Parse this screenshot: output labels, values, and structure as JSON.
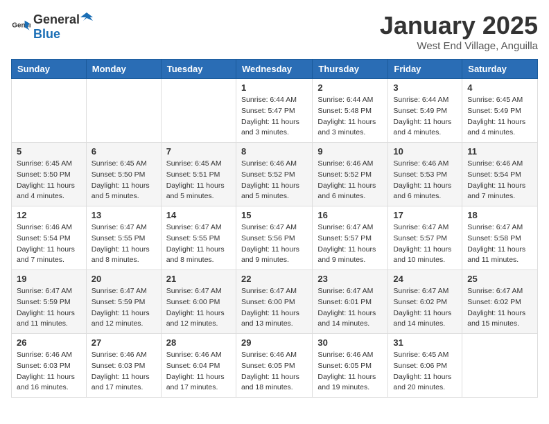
{
  "header": {
    "logo_general": "General",
    "logo_blue": "Blue",
    "month_year": "January 2025",
    "location": "West End Village, Anguilla"
  },
  "weekdays": [
    "Sunday",
    "Monday",
    "Tuesday",
    "Wednesday",
    "Thursday",
    "Friday",
    "Saturday"
  ],
  "weeks": [
    [
      {
        "day": "",
        "info": ""
      },
      {
        "day": "",
        "info": ""
      },
      {
        "day": "",
        "info": ""
      },
      {
        "day": "1",
        "info": "Sunrise: 6:44 AM\nSunset: 5:47 PM\nDaylight: 11 hours\nand 3 minutes."
      },
      {
        "day": "2",
        "info": "Sunrise: 6:44 AM\nSunset: 5:48 PM\nDaylight: 11 hours\nand 3 minutes."
      },
      {
        "day": "3",
        "info": "Sunrise: 6:44 AM\nSunset: 5:49 PM\nDaylight: 11 hours\nand 4 minutes."
      },
      {
        "day": "4",
        "info": "Sunrise: 6:45 AM\nSunset: 5:49 PM\nDaylight: 11 hours\nand 4 minutes."
      }
    ],
    [
      {
        "day": "5",
        "info": "Sunrise: 6:45 AM\nSunset: 5:50 PM\nDaylight: 11 hours\nand 4 minutes."
      },
      {
        "day": "6",
        "info": "Sunrise: 6:45 AM\nSunset: 5:50 PM\nDaylight: 11 hours\nand 5 minutes."
      },
      {
        "day": "7",
        "info": "Sunrise: 6:45 AM\nSunset: 5:51 PM\nDaylight: 11 hours\nand 5 minutes."
      },
      {
        "day": "8",
        "info": "Sunrise: 6:46 AM\nSunset: 5:52 PM\nDaylight: 11 hours\nand 5 minutes."
      },
      {
        "day": "9",
        "info": "Sunrise: 6:46 AM\nSunset: 5:52 PM\nDaylight: 11 hours\nand 6 minutes."
      },
      {
        "day": "10",
        "info": "Sunrise: 6:46 AM\nSunset: 5:53 PM\nDaylight: 11 hours\nand 6 minutes."
      },
      {
        "day": "11",
        "info": "Sunrise: 6:46 AM\nSunset: 5:54 PM\nDaylight: 11 hours\nand 7 minutes."
      }
    ],
    [
      {
        "day": "12",
        "info": "Sunrise: 6:46 AM\nSunset: 5:54 PM\nDaylight: 11 hours\nand 7 minutes."
      },
      {
        "day": "13",
        "info": "Sunrise: 6:47 AM\nSunset: 5:55 PM\nDaylight: 11 hours\nand 8 minutes."
      },
      {
        "day": "14",
        "info": "Sunrise: 6:47 AM\nSunset: 5:55 PM\nDaylight: 11 hours\nand 8 minutes."
      },
      {
        "day": "15",
        "info": "Sunrise: 6:47 AM\nSunset: 5:56 PM\nDaylight: 11 hours\nand 9 minutes."
      },
      {
        "day": "16",
        "info": "Sunrise: 6:47 AM\nSunset: 5:57 PM\nDaylight: 11 hours\nand 9 minutes."
      },
      {
        "day": "17",
        "info": "Sunrise: 6:47 AM\nSunset: 5:57 PM\nDaylight: 11 hours\nand 10 minutes."
      },
      {
        "day": "18",
        "info": "Sunrise: 6:47 AM\nSunset: 5:58 PM\nDaylight: 11 hours\nand 11 minutes."
      }
    ],
    [
      {
        "day": "19",
        "info": "Sunrise: 6:47 AM\nSunset: 5:59 PM\nDaylight: 11 hours\nand 11 minutes."
      },
      {
        "day": "20",
        "info": "Sunrise: 6:47 AM\nSunset: 5:59 PM\nDaylight: 11 hours\nand 12 minutes."
      },
      {
        "day": "21",
        "info": "Sunrise: 6:47 AM\nSunset: 6:00 PM\nDaylight: 11 hours\nand 12 minutes."
      },
      {
        "day": "22",
        "info": "Sunrise: 6:47 AM\nSunset: 6:00 PM\nDaylight: 11 hours\nand 13 minutes."
      },
      {
        "day": "23",
        "info": "Sunrise: 6:47 AM\nSunset: 6:01 PM\nDaylight: 11 hours\nand 14 minutes."
      },
      {
        "day": "24",
        "info": "Sunrise: 6:47 AM\nSunset: 6:02 PM\nDaylight: 11 hours\nand 14 minutes."
      },
      {
        "day": "25",
        "info": "Sunrise: 6:47 AM\nSunset: 6:02 PM\nDaylight: 11 hours\nand 15 minutes."
      }
    ],
    [
      {
        "day": "26",
        "info": "Sunrise: 6:46 AM\nSunset: 6:03 PM\nDaylight: 11 hours\nand 16 minutes."
      },
      {
        "day": "27",
        "info": "Sunrise: 6:46 AM\nSunset: 6:03 PM\nDaylight: 11 hours\nand 17 minutes."
      },
      {
        "day": "28",
        "info": "Sunrise: 6:46 AM\nSunset: 6:04 PM\nDaylight: 11 hours\nand 17 minutes."
      },
      {
        "day": "29",
        "info": "Sunrise: 6:46 AM\nSunset: 6:05 PM\nDaylight: 11 hours\nand 18 minutes."
      },
      {
        "day": "30",
        "info": "Sunrise: 6:46 AM\nSunset: 6:05 PM\nDaylight: 11 hours\nand 19 minutes."
      },
      {
        "day": "31",
        "info": "Sunrise: 6:45 AM\nSunset: 6:06 PM\nDaylight: 11 hours\nand 20 minutes."
      },
      {
        "day": "",
        "info": ""
      }
    ]
  ]
}
